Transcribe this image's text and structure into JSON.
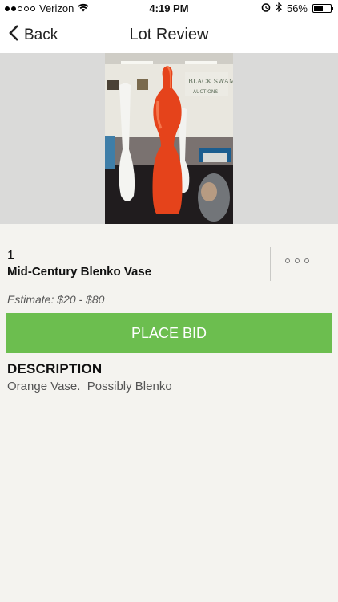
{
  "status_bar": {
    "carrier": "Verizon",
    "time": "4:19 PM",
    "battery": "56%",
    "battery_level": 0.56,
    "signal_dots_filled": 2,
    "signal_dots_total": 5
  },
  "nav": {
    "back_label": "Back",
    "title": "Lot Review"
  },
  "lot": {
    "number": "1",
    "title": "Mid-Century Blenko Vase",
    "estimate": "Estimate: $20 - $80",
    "photo_sign": "BLACK SWAMP AUCTIONS"
  },
  "actions": {
    "place_bid": "PLACE BID"
  },
  "description": {
    "heading": "DESCRIPTION",
    "text": "Orange Vase.  Possibly Blenko"
  },
  "colors": {
    "accent_green": "#6cbe4f",
    "vase_orange": "#e5431b"
  }
}
